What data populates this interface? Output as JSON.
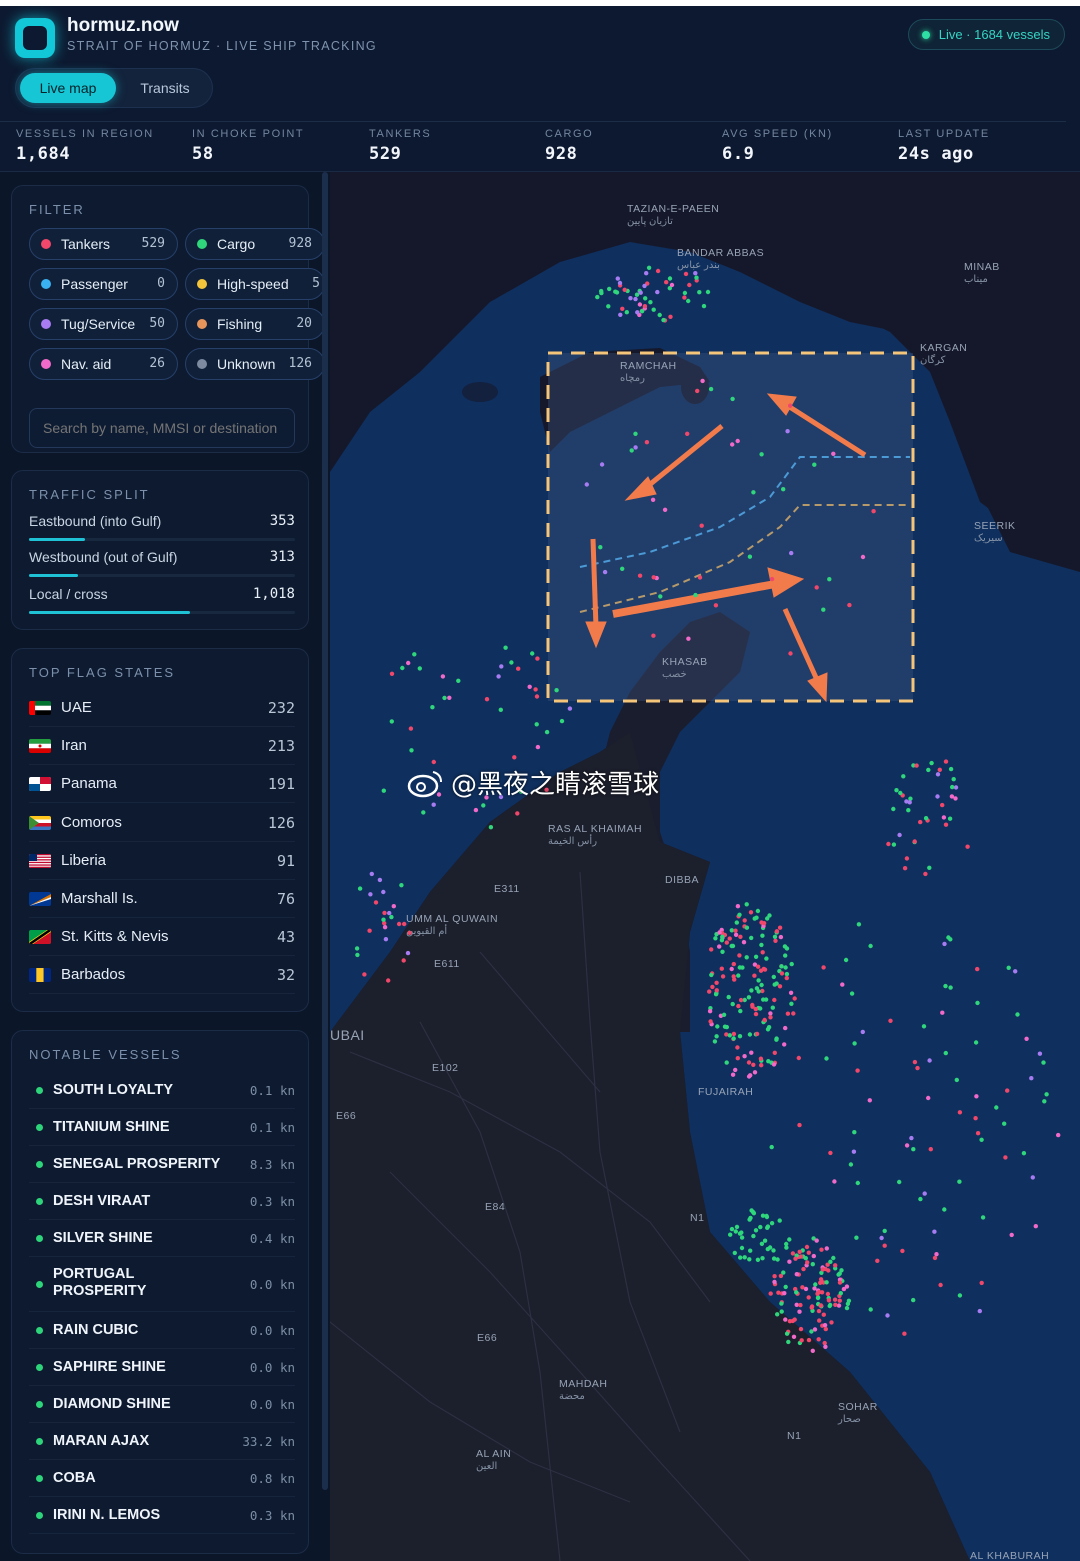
{
  "app": {
    "name": "hormuz.now",
    "subtitle": "STRAIT OF HORMUZ · LIVE SHIP TRACKING",
    "live_badge": "Live · 1684 vessels",
    "accent": "#16c6d4"
  },
  "tabs": [
    {
      "label": "Live map",
      "active": true
    },
    {
      "label": "Transits",
      "active": false
    }
  ],
  "stats": [
    {
      "label": "VESSELS IN REGION",
      "value": "1,684"
    },
    {
      "label": "IN CHOKE POINT",
      "value": "58"
    },
    {
      "label": "TANKERS",
      "value": "529"
    },
    {
      "label": "CARGO",
      "value": "928"
    },
    {
      "label": "AVG SPEED (KN)",
      "value": "6.9"
    },
    {
      "label": "LAST UPDATE",
      "value": "24s ago"
    }
  ],
  "filter": {
    "title": "FILTER",
    "chips": [
      {
        "label": "Tankers",
        "count": "529",
        "color": "#f0476a"
      },
      {
        "label": "Cargo",
        "count": "928",
        "color": "#2fd67b"
      },
      {
        "label": "Passenger",
        "count": "0",
        "color": "#3ab1f0"
      },
      {
        "label": "High-speed",
        "count": "5",
        "color": "#f4c53b"
      },
      {
        "label": "Tug/Service",
        "count": "50",
        "color": "#a77cf2"
      },
      {
        "label": "Fishing",
        "count": "20",
        "color": "#e8955c"
      },
      {
        "label": "Nav. aid",
        "count": "26",
        "color": "#f26ac9"
      },
      {
        "label": "Unknown",
        "count": "126",
        "color": "#7d8aa0"
      }
    ],
    "search_placeholder": "Search by name, MMSI or destination"
  },
  "traffic_split": {
    "title": "TRAFFIC SPLIT",
    "rows": [
      {
        "label": "Eastbound (into Gulf)",
        "value": "353",
        "fraction": 0.21
      },
      {
        "label": "Westbound (out of Gulf)",
        "value": "313",
        "fraction": 0.186
      },
      {
        "label": "Local / cross",
        "value": "1,018",
        "fraction": 0.605
      }
    ]
  },
  "flag_states": {
    "title": "TOP FLAG STATES",
    "rows": [
      {
        "name": "UAE",
        "count": "232",
        "flag": "uae"
      },
      {
        "name": "Iran",
        "count": "213",
        "flag": "iran"
      },
      {
        "name": "Panama",
        "count": "191",
        "flag": "panama"
      },
      {
        "name": "Comoros",
        "count": "126",
        "flag": "comoros"
      },
      {
        "name": "Liberia",
        "count": "91",
        "flag": "liberia"
      },
      {
        "name": "Marshall Is.",
        "count": "76",
        "flag": "marshall"
      },
      {
        "name": "St. Kitts & Nevis",
        "count": "43",
        "flag": "stkitts"
      },
      {
        "name": "Barbados",
        "count": "32",
        "flag": "barbados"
      }
    ]
  },
  "notable_vessels": {
    "title": "NOTABLE VESSELS",
    "rows": [
      {
        "name": "SOUTH LOYALTY",
        "speed": "0.1 kn"
      },
      {
        "name": "TITANIUM SHINE",
        "speed": "0.1 kn"
      },
      {
        "name": "SENEGAL PROSPERITY",
        "speed": "8.3 kn"
      },
      {
        "name": "DESH VIRAAT",
        "speed": "0.3 kn"
      },
      {
        "name": "SILVER SHINE",
        "speed": "0.4 kn"
      },
      {
        "name": "PORTUGAL PROSPERITY",
        "speed": "0.0 kn"
      },
      {
        "name": "RAIN CUBIC",
        "speed": "0.0 kn"
      },
      {
        "name": "SAPHIRE SHINE",
        "speed": "0.0 kn"
      },
      {
        "name": "DIAMOND SHINE",
        "speed": "0.0 kn"
      },
      {
        "name": "MARAN AJAX",
        "speed": "33.2 kn"
      },
      {
        "name": "COBA",
        "speed": "0.8 kn"
      },
      {
        "name": "IRINI N. LEMOS",
        "speed": "0.3 kn"
      }
    ]
  },
  "map": {
    "places": [
      {
        "name": "TAZIAN-E-PAEEN",
        "sub": "تازیان پایین"
      },
      {
        "name": "BANDAR ABBAS",
        "sub": "بندر عباس"
      },
      {
        "name": "MINAB",
        "sub": "میناب"
      },
      {
        "name": "KARGAN",
        "sub": "کرگان"
      },
      {
        "name": "RAMCHAH",
        "sub": "رمچاه"
      },
      {
        "name": "SEERIK",
        "sub": "سیریک"
      },
      {
        "name": "KHASAB",
        "sub": "خصب"
      },
      {
        "name": "RAS AL KHAIMAH",
        "sub": "رأس الخيمة"
      },
      {
        "name": "DIBBA",
        "sub": ""
      },
      {
        "name": "UMM AL QUWAIN",
        "sub": "أم القيوين"
      },
      {
        "name": "UBAI",
        "sub": ""
      },
      {
        "name": "FUJAIRAH",
        "sub": ""
      },
      {
        "name": "MAHDAH",
        "sub": "محضة"
      },
      {
        "name": "SOHAR",
        "sub": "صحار"
      },
      {
        "name": "AL AIN",
        "sub": "العين"
      },
      {
        "name": "AL KHABURAH",
        "sub": ""
      }
    ],
    "roads": [
      "E311",
      "E611",
      "E102",
      "E66",
      "E84",
      "N1",
      "E66",
      "N1"
    ],
    "watermark": "@黑夜之睛滚雪球"
  }
}
